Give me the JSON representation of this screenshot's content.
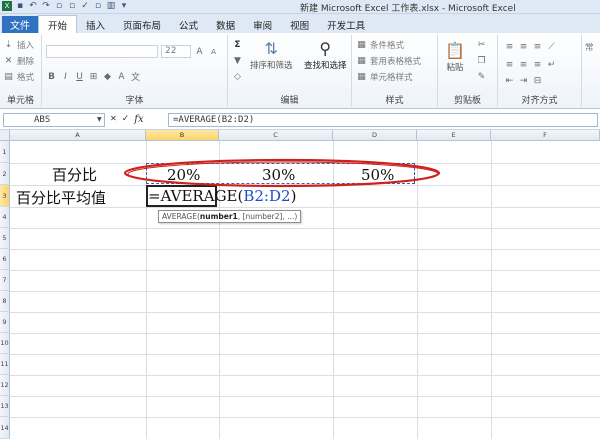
{
  "window": {
    "title": "新建 Microsoft Excel 工作表.xlsx - Microsoft Excel"
  },
  "tabs": {
    "file": "文件",
    "items": [
      "开始",
      "插入",
      "页面布局",
      "公式",
      "数据",
      "审阅",
      "视图",
      "开发工具"
    ],
    "active": "开始"
  },
  "ribbon": {
    "cells_group": {
      "insert": "插入",
      "delete": "删除",
      "format": "格式",
      "label": "单元格"
    },
    "font_group": {
      "font_size": "22",
      "label": "字体"
    },
    "editing_group": {
      "sort_filter": "排序和筛选",
      "find_select": "查找和选择",
      "label": "编辑"
    },
    "styles_group": {
      "conditional": "条件格式",
      "table_format": "套用表格格式",
      "cell_styles": "单元格样式",
      "label": "样式"
    },
    "clipboard_group": {
      "paste": "粘贴",
      "label": "剪贴板"
    },
    "alignment_group": {
      "label": "对齐方式"
    },
    "number_group": {
      "label": "常"
    }
  },
  "formula_bar": {
    "name_box": "ABS",
    "fx": "fx",
    "content": "=AVERAGE(B2:D2)"
  },
  "sheet": {
    "columns": [
      "A",
      "B",
      "C",
      "D",
      "E",
      "F"
    ],
    "selected_column": "B",
    "rows": [
      "1",
      "2",
      "3",
      "4",
      "5",
      "6",
      "7",
      "8",
      "9",
      "10",
      "11",
      "12",
      "13",
      "14"
    ],
    "selected_row": "3",
    "cells": {
      "A2": "百分比",
      "B2": "20%",
      "C2": "30%",
      "D2": "50%",
      "A3": "百分比平均值"
    },
    "editing": {
      "prefix": "=AVERAGE(",
      "ref": "B2:D2",
      "suffix": ")"
    },
    "tooltip": {
      "func": "AVERAGE(",
      "arg1": "number1",
      "rest": ", [number2], ...)"
    }
  },
  "annotation": {
    "color": "#d0201a"
  }
}
